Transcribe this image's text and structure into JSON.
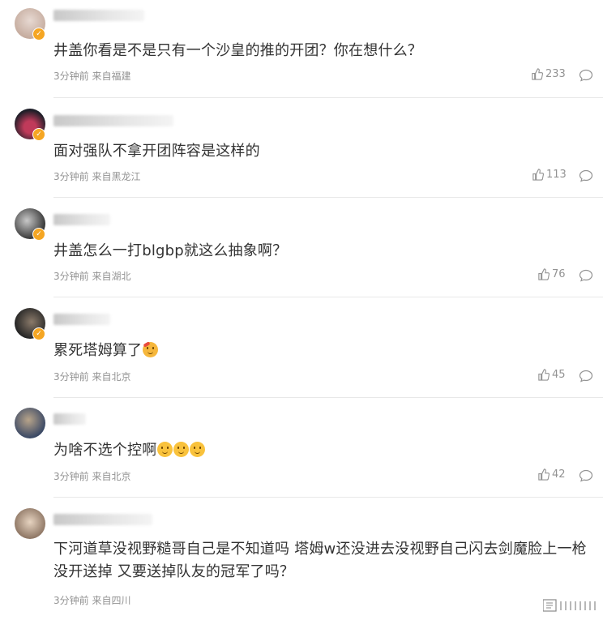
{
  "comments": [
    {
      "text": "井盖你看是不是只有一个沙皇的推的开团？你在想什么？",
      "meta": "3分钟前 来自福建",
      "likes": "233",
      "avatar_colors": [
        "#d9c8c0",
        "#a88a7c"
      ]
    },
    {
      "text": "面对强队不拿开团阵容是这样的",
      "meta": "3分钟前 来自黑龙江",
      "likes": "113",
      "avatar_colors": [
        "#2a2a35",
        "#c03a5a"
      ]
    },
    {
      "text": "井盖怎么一打blgbp就这么抽象啊？",
      "meta": "3分钟前 来自湖北",
      "likes": "76",
      "avatar_colors": [
        "#3a3a3a",
        "#c8c8c8"
      ]
    },
    {
      "text": "累死塔姆算了",
      "meta": "3分钟前 来自北京",
      "likes": "45",
      "avatar_colors": [
        "#2b2b2b",
        "#8a7a6a"
      ]
    },
    {
      "text": "为啥不选个控啊",
      "meta": "3分钟前 来自北京",
      "likes": "42",
      "avatar_colors": [
        "#4a5a7a",
        "#b8a48a"
      ]
    },
    {
      "text": "下河道草没视野糙哥自己是不知道吗 塔姆w还没进去没视野自己闪去剑魔脸上一枪没开送掉 又要送掉队友的冠军了吗？",
      "meta": "3分钟前 来自四川",
      "likes": "",
      "avatar_colors": [
        "#d8c4b0",
        "#7a6656"
      ]
    }
  ],
  "icons": {
    "like": "thumbs-up-icon",
    "reply": "comment-bubble-icon",
    "verified": "verified-badge-icon"
  },
  "colors": {
    "text": "#333333",
    "meta": "#939393",
    "badge": "#f5a623"
  }
}
